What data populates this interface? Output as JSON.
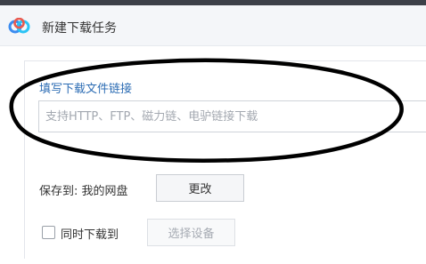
{
  "dialog": {
    "title": "新建下载任务",
    "logo_icon": "baidu-netdisk-logo-icon"
  },
  "link_section": {
    "label": "填写下载文件链接",
    "input_value": "",
    "input_placeholder": "支持HTTP、FTP、磁力链、电驴链接下载"
  },
  "save_section": {
    "label": "保存到: 我的网盘",
    "change_button": "更改"
  },
  "sync_section": {
    "checkbox_label": "同时下载到",
    "checked": false,
    "device_button": "选择设备"
  },
  "colors": {
    "accent": "#2d6db4",
    "annotation": "#000000"
  }
}
